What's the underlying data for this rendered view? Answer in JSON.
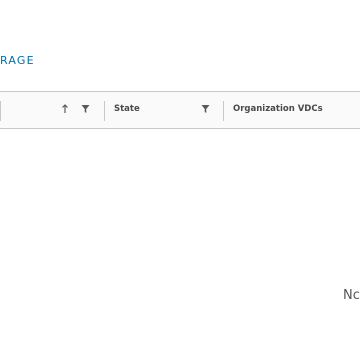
{
  "section": {
    "title": "RAGE"
  },
  "grid": {
    "columns": [
      {
        "label": "State",
        "sortable": false,
        "filter_icon": "filter-icon"
      },
      {
        "label": "Organization VDCs",
        "sortable": false
      }
    ],
    "first_column_icons": [
      "sort-arrow-up-icon",
      "filter-icon"
    ],
    "empty_message": "Nc"
  }
}
